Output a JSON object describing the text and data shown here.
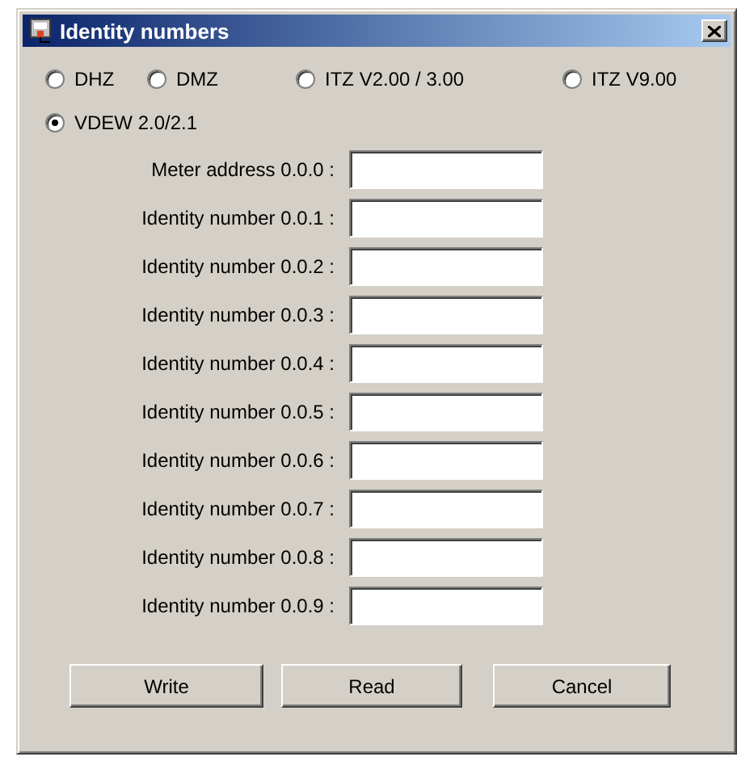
{
  "window": {
    "title": "Identity numbers"
  },
  "meter_types": [
    {
      "label": "DHZ",
      "selected": false
    },
    {
      "label": "DMZ",
      "selected": false
    },
    {
      "label": "ITZ V2.00 / 3.00",
      "selected": false
    },
    {
      "label": "ITZ V9.00",
      "selected": false
    },
    {
      "label": "VDEW 2.0/2.1",
      "selected": true
    }
  ],
  "fields": [
    {
      "label": "Meter address 0.0.0 :"
    },
    {
      "label": "Identity number 0.0.1 :"
    },
    {
      "label": "Identity number 0.0.2 :"
    },
    {
      "label": "Identity number 0.0.3 :"
    },
    {
      "label": "Identity number 0.0.4 :"
    },
    {
      "label": "Identity number 0.0.5 :"
    },
    {
      "label": "Identity number 0.0.6 :"
    },
    {
      "label": "Identity number 0.0.7 :"
    },
    {
      "label": "Identity number 0.0.8 :"
    },
    {
      "label": "Identity number 0.0.9 :"
    }
  ],
  "buttons": [
    "Write",
    "Read",
    "Cancel"
  ]
}
